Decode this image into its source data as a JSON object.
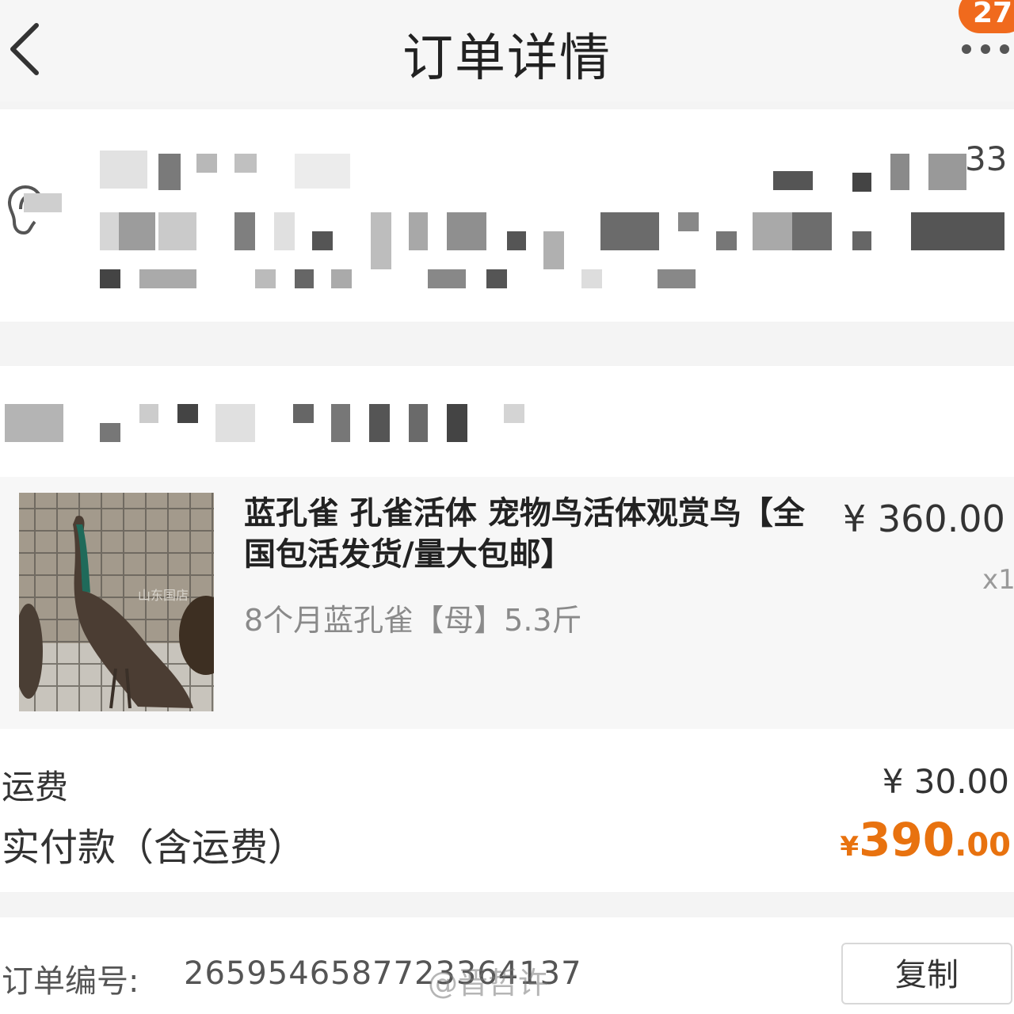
{
  "header": {
    "title": "订单详情",
    "badge_count": "27"
  },
  "address": {
    "suffix": "33"
  },
  "product": {
    "title": "蓝孔雀 孔雀活体 宠物鸟活体观赏鸟【全国包活发货/量大包邮】",
    "sku": "8个月蓝孔雀【母】5.3斤",
    "price": "¥ 360.00",
    "quantity": "x1",
    "image_watermark": "山东国店"
  },
  "totals": {
    "shipping_label": "运费",
    "shipping_value": "¥ 30.00",
    "paid_label": "实付款（含运费）",
    "paid_symbol": "¥",
    "paid_integer": "390",
    "paid_decimal": ".00"
  },
  "order": {
    "number_label": "订单编号:",
    "number_value": "2659546587723364137",
    "copy_label": "复制"
  },
  "watermark": "@晋哲许",
  "colors": {
    "accent": "#e8720f",
    "badge": "#f06a1d"
  }
}
